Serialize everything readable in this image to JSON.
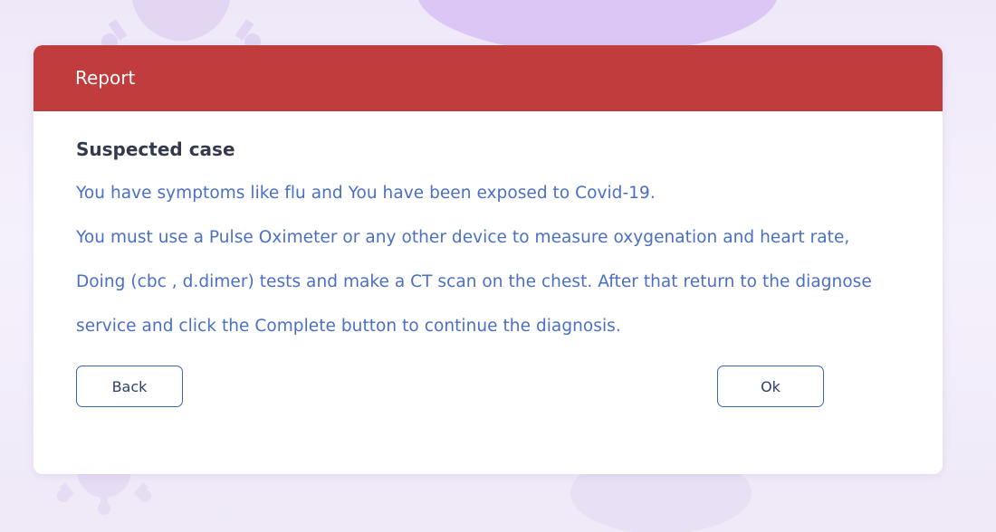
{
  "dialog": {
    "header_title": "Report",
    "header_color": "#c13c3c",
    "case_title": "Suspected case",
    "message_line_1": "You have symptoms like flu and You have been exposed to Covid-19.",
    "message_line_2": "You must use a Pulse Oximeter or any other device to measure oxygenation and heart rate, Doing (cbc , d.dimer) tests and make a CT scan on the chest. After that return to the diagnose service and click the Complete button to continue the diagnosis.",
    "text_color": "#4a6fc4",
    "back_label": "Back",
    "ok_label": "Ok"
  },
  "background": {
    "decoration_icon": "virus-icon"
  }
}
